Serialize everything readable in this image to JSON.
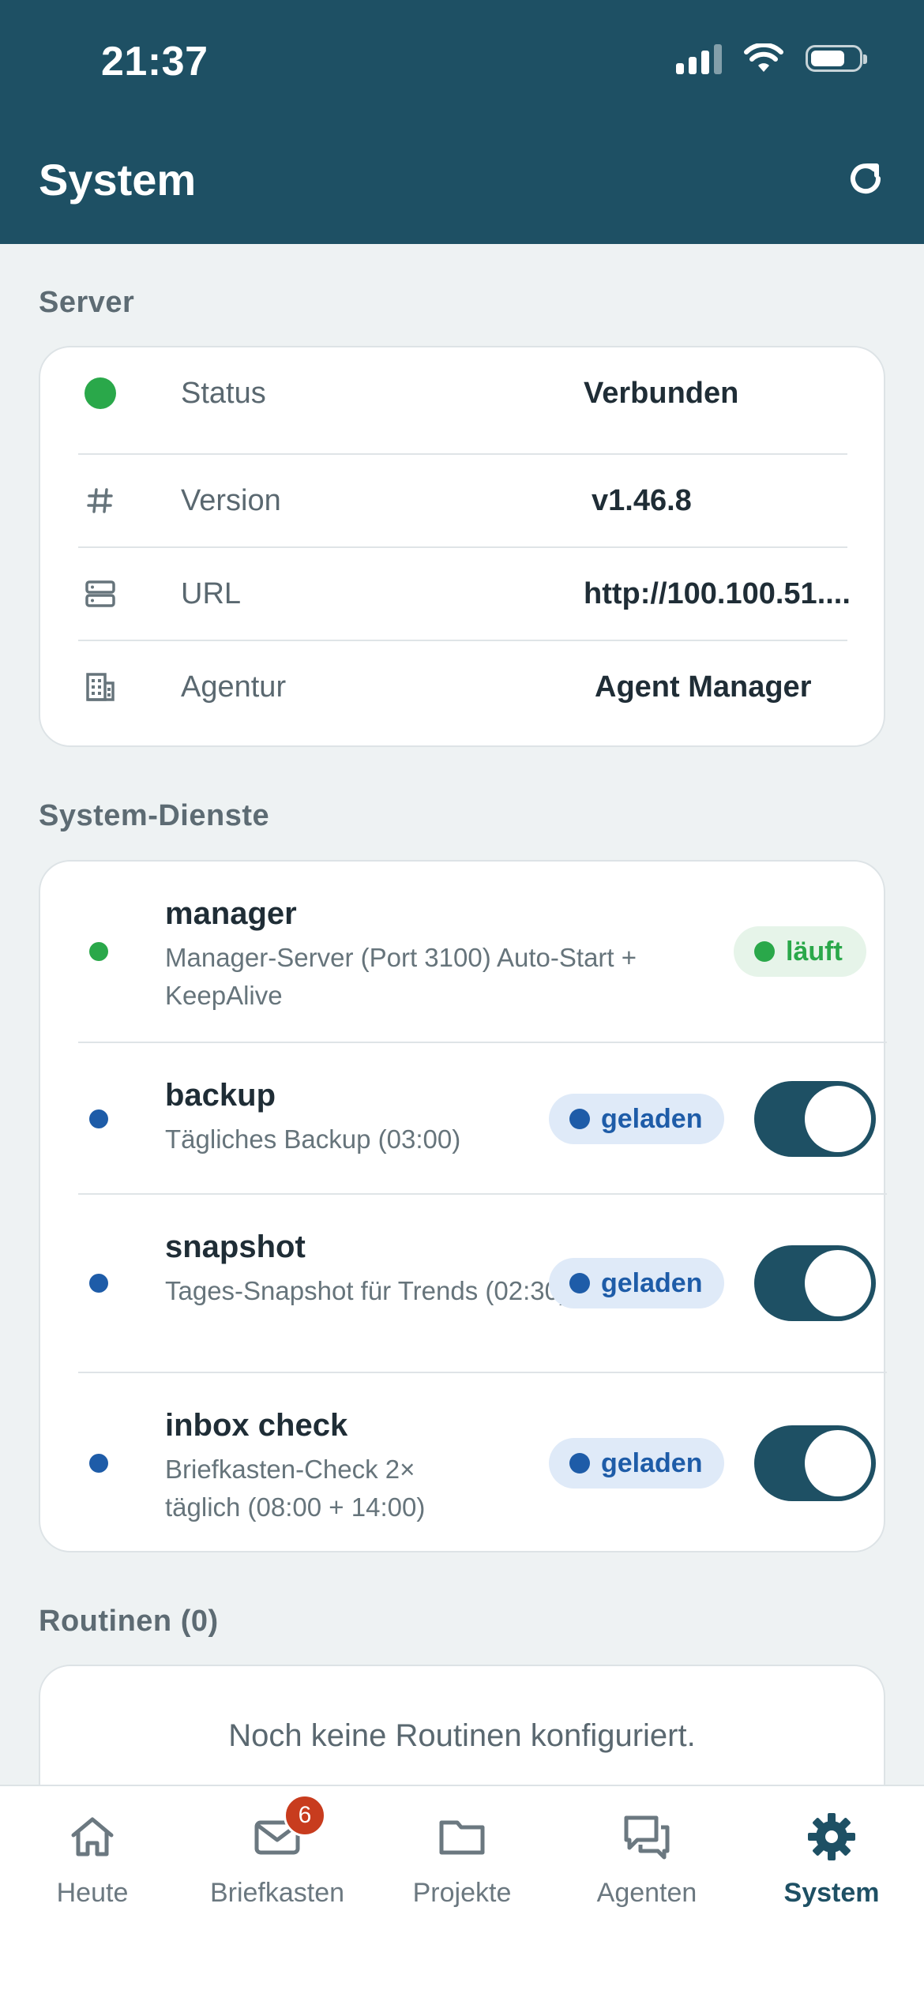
{
  "status_bar": {
    "time": "21:37"
  },
  "header": {
    "title": "System"
  },
  "server": {
    "section_title": "Server",
    "rows": [
      {
        "icon": "status-dot",
        "label": "Status",
        "value": "Verbunden"
      },
      {
        "icon": "hash-icon",
        "label": "Version",
        "value": "v1.46.8"
      },
      {
        "icon": "server-icon",
        "label": "URL",
        "value": "http://100.100.51...."
      },
      {
        "icon": "building-icon",
        "label": "Agentur",
        "value": "Agent Manager"
      }
    ]
  },
  "services": {
    "section_title": "System-Dienste",
    "items": [
      {
        "name": "manager",
        "description": "Manager-Server (Port 3100) Auto-Start + KeepAlive",
        "status": "läuft",
        "dot_color": "#2aa84a"
      },
      {
        "name": "backup",
        "description": "Tägliches Backup (03:00)",
        "status": "geladen",
        "dot_color": "#1e5ca8",
        "enabled": true
      },
      {
        "name": "snapshot",
        "description": "Tages-Snapshot für Trends (02:30)",
        "status": "geladen",
        "dot_color": "#1e5ca8",
        "enabled": true
      },
      {
        "name": "inbox check",
        "description": "Briefkasten-Check 2× täglich (08:00 + 14:00)",
        "status": "geladen",
        "dot_color": "#1e5ca8",
        "enabled": true
      }
    ]
  },
  "routines": {
    "section_title": "Routinen (0)",
    "empty_text": "Noch keine Routinen konfiguriert."
  },
  "tabbar": {
    "tabs": [
      {
        "label": "Heute",
        "icon": "home-icon"
      },
      {
        "label": "Briefkasten",
        "icon": "mail-icon",
        "badge": "6"
      },
      {
        "label": "Projekte",
        "icon": "folder-icon"
      },
      {
        "label": "Agenten",
        "icon": "chat-icon"
      },
      {
        "label": "System",
        "icon": "gear-icon",
        "active": true
      }
    ]
  },
  "colors": {
    "header": "#1e5064",
    "accent": "#1e5064",
    "running": "#2aa84a",
    "loaded": "#1e5ca8",
    "badge": "#c83c1e"
  }
}
